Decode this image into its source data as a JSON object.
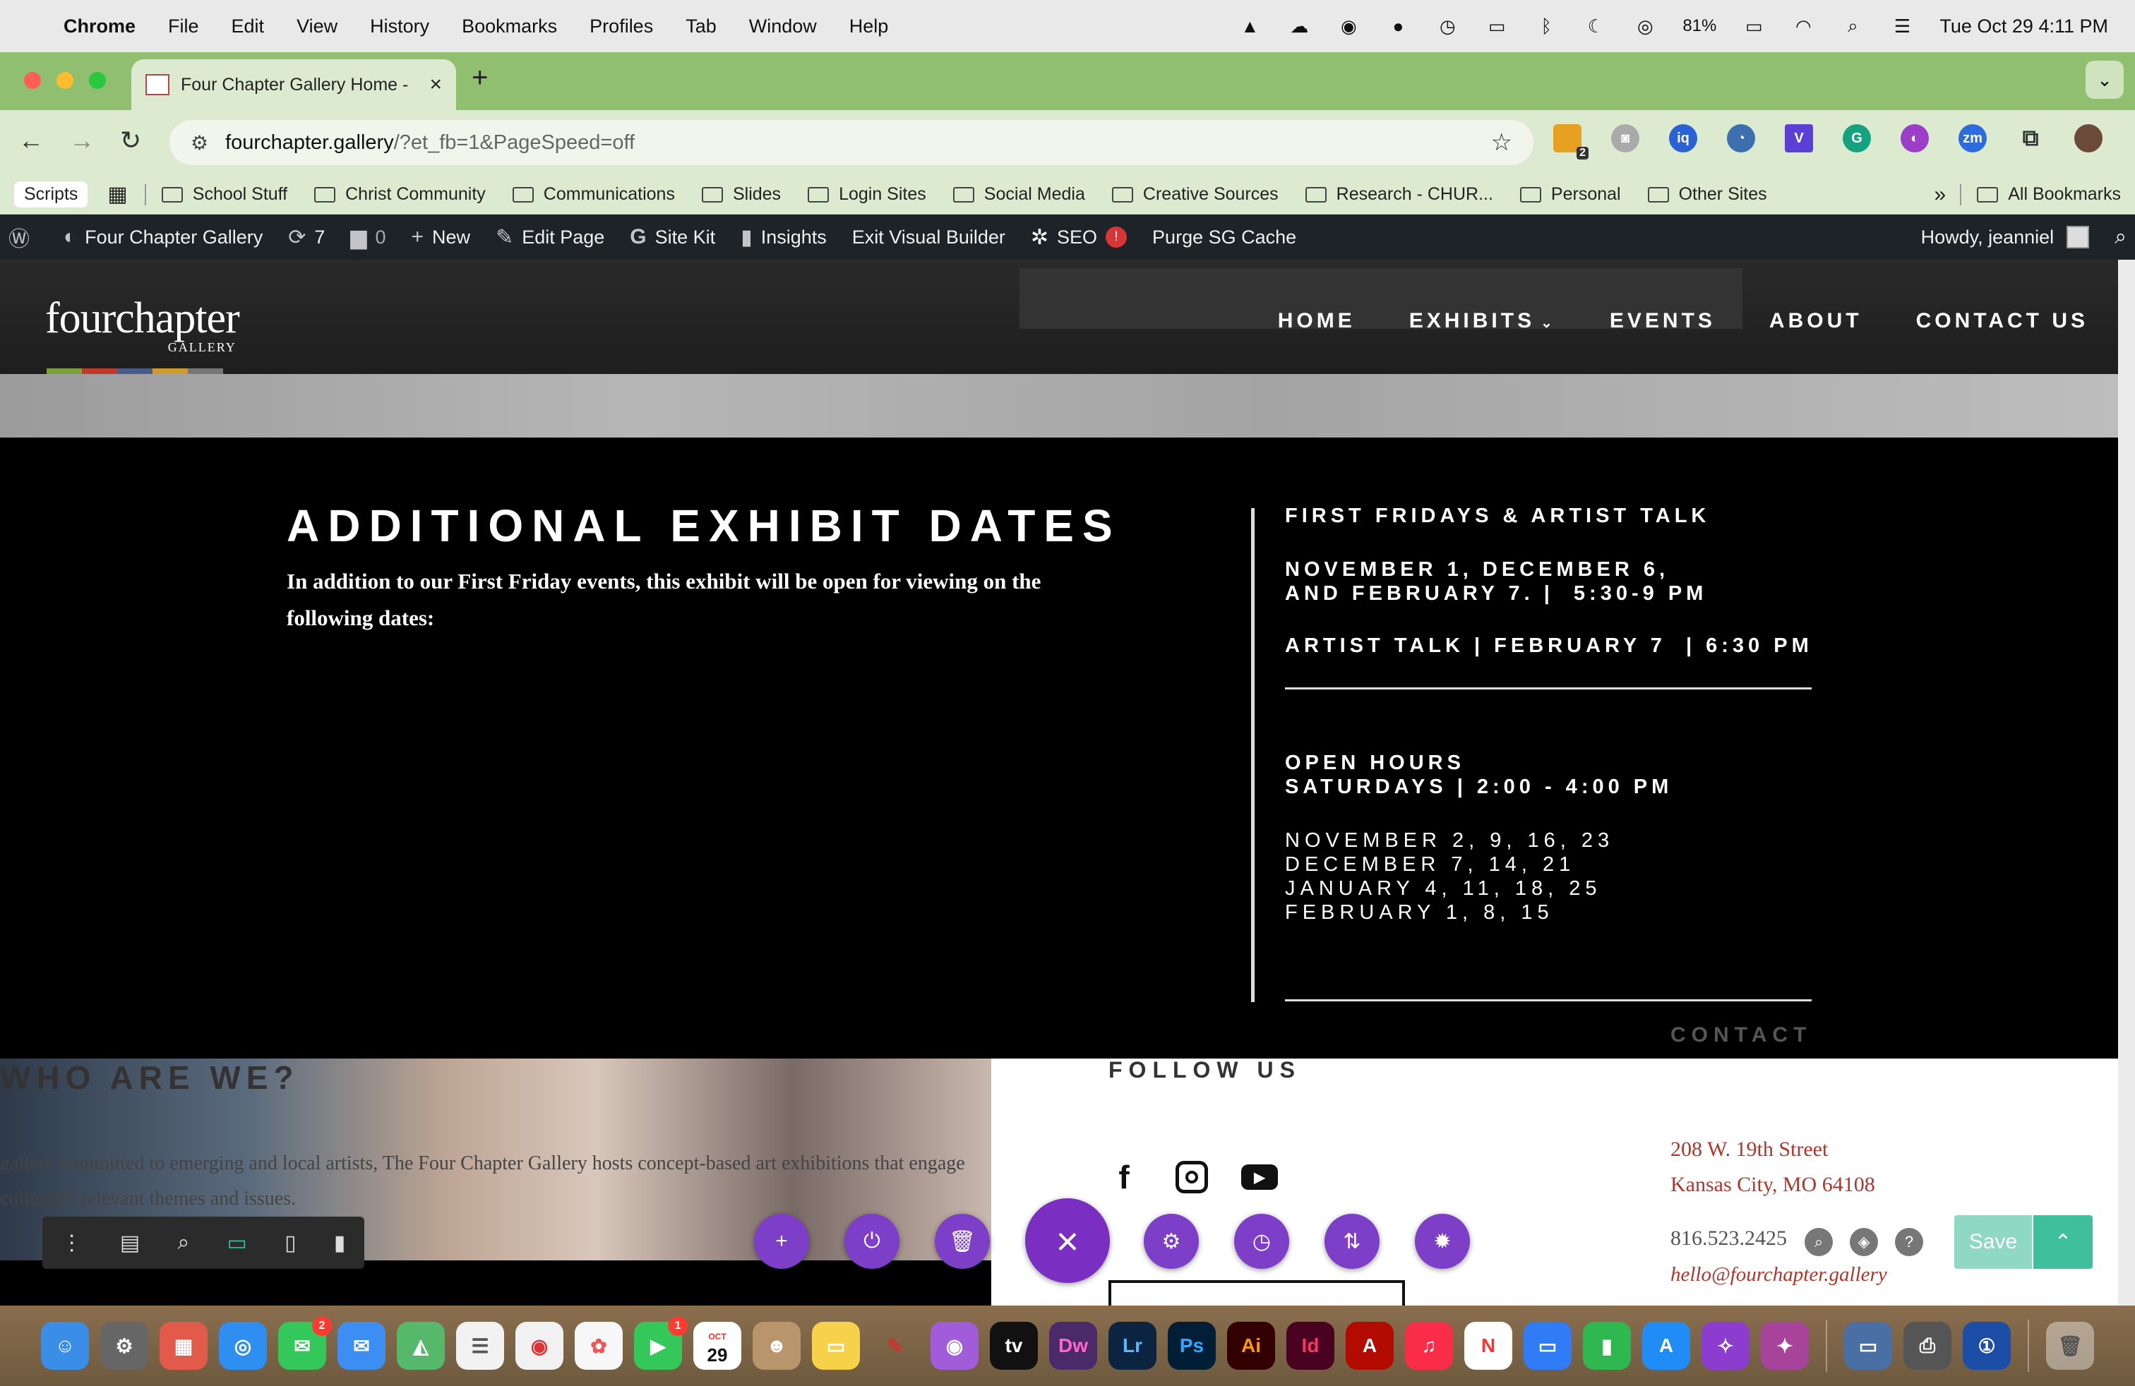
{
  "menubar": {
    "app": "Chrome",
    "items": [
      "File",
      "Edit",
      "View",
      "History",
      "Bookmarks",
      "Profiles",
      "Tab",
      "Window",
      "Help"
    ],
    "battery": "81%",
    "datetime": "Tue Oct 29  4:11 PM"
  },
  "browser": {
    "tab_title": "Four Chapter Gallery Home -",
    "url_host": "fourchapter.gallery",
    "url_path": "/?et_fb=1&PageSpeed=off",
    "ext_badge": "2"
  },
  "bookmarks": {
    "scripts": "Scripts",
    "folders": [
      "School Stuff",
      "Christ Community",
      "Communications",
      "Slides",
      "Login Sites",
      "Social Media",
      "Creative Sources",
      "Research - CHUR...",
      "Personal",
      "Other Sites"
    ],
    "overflow": "»",
    "all": "All Bookmarks"
  },
  "adminbar": {
    "site": "Four Chapter Gallery",
    "updates": "7",
    "comments": "0",
    "new": "New",
    "edit_page": "Edit Page",
    "site_kit": "Site Kit",
    "insights": "Insights",
    "exit_builder": "Exit Visual Builder",
    "seo": "SEO",
    "seo_badge": "!",
    "purge": "Purge SG Cache",
    "howdy": "Howdy, jeanniel"
  },
  "site": {
    "logo_text": "fourchapter",
    "logo_sub": "GALLERY",
    "nav": [
      "HOME",
      "EXHIBITS",
      "EVENTS",
      "ABOUT",
      "CONTACT US"
    ]
  },
  "exhibit": {
    "heading": "ADDITIONAL EXHIBIT DATES",
    "body": "In addition to our First Friday events, this exhibit will be open for viewing on the following dates:",
    "ff_title": "FIRST FRIDAYS & ARTIST TALK",
    "ff_dates": "NOVEMBER 1, DECEMBER 6,\nAND FEBRUARY 7. |  5:30-9 PM",
    "artist_talk": "ARTIST TALK | FEBRUARY 7  | 6:30 PM",
    "open_hours": "OPEN HOURS\nSATURDAYS | 2:00 - 4:00 PM",
    "saturday_dates": "NOVEMBER 2, 9, 16, 23\nDECEMBER 7, 14, 21\nJANUARY 4, 11, 18, 25\nFEBRUARY 1, 8, 15",
    "contact_label": "CONTACT"
  },
  "footer": {
    "who_heading": "WHO ARE WE?",
    "who_text": "gallery committed to emerging and local artists, The Four Chapter Gallery hosts concept-based art exhibitions that engage culturally relevant themes and issues.",
    "follow_us": "FOLLOW US",
    "address_1": "208 W. 19th Street",
    "address_2": "Kansas City, MO 64108",
    "phone": "816.523.2425",
    "email": "hello@fourchapter.gallery"
  },
  "divi": {
    "save": "Save"
  },
  "dock": {
    "messages_badge": "2",
    "facetime_badge": "1",
    "calendar_month": "OCT",
    "calendar_day": "29"
  }
}
